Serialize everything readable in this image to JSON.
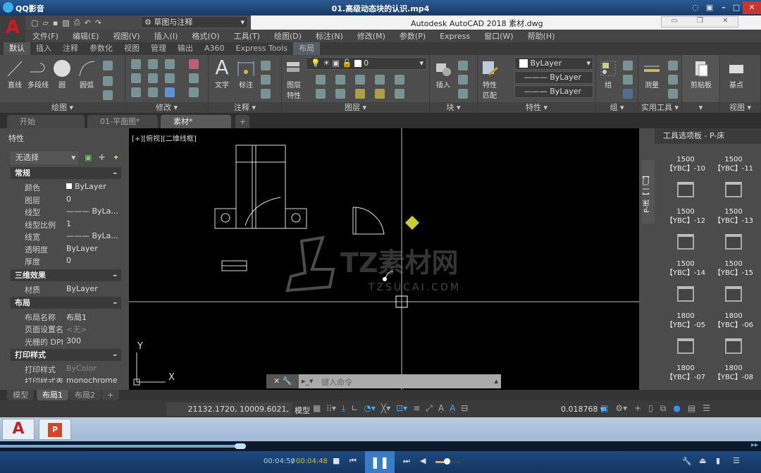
{
  "player": {
    "app_name": "QQ影音",
    "title": "01.高级动态块的认识.mp4",
    "time_current": "00:04:50",
    "time_total": "00:04:48",
    "progress_fraction": 0.32,
    "volume_fraction": 0.45
  },
  "acad": {
    "title": "Autodesk AutoCAD 2018    素材.dwg",
    "logo": "A",
    "workspace": "草图与注释"
  },
  "menu": [
    "文件(F)",
    "编辑(E)",
    "视图(V)",
    "插入(I)",
    "格式(O)",
    "工具(T)",
    "绘图(D)",
    "标注(N)",
    "修改(M)",
    "参数(P)",
    "Express",
    "窗口(W)",
    "帮助(H)"
  ],
  "ribbon_tabs": [
    "默认",
    "插入",
    "注释",
    "参数化",
    "视图",
    "管理",
    "输出",
    "A360",
    "Express Tools",
    "布局"
  ],
  "panels": {
    "draw": {
      "label": "绘图",
      "tools": [
        "直线",
        "多段线",
        "圆",
        "圆弧"
      ]
    },
    "modify": {
      "label": "修改"
    },
    "annotate": {
      "label": "注释",
      "tools": [
        "文字",
        "标注"
      ]
    },
    "layers": {
      "label": "图层",
      "tool": "图层\n特性",
      "layer_value": "0"
    },
    "block": {
      "label": "块",
      "tool": "插入"
    },
    "properties": {
      "label": "特性",
      "tool": "特性\n匹配",
      "color": "ByLayer",
      "linetype": "ByLayer",
      "lineweight": "ByLayer"
    },
    "group": {
      "label": "组",
      "tool": "组"
    },
    "utilities": {
      "label": "实用工具",
      "tool": "测量"
    },
    "clipboard": {
      "tool": "剪贴板"
    },
    "view": {
      "label": "视图",
      "tool": "基点"
    }
  },
  "file_tabs": [
    "开始",
    "01-平面图*",
    "素材*"
  ],
  "properties": {
    "title": "特性",
    "selection": "无选择",
    "sections": [
      {
        "name": "常规",
        "rows": [
          [
            "颜色",
            "ByLayer"
          ],
          [
            "图层",
            "0"
          ],
          [
            "线型",
            "——— ByLa..."
          ],
          [
            "线型比例",
            "1"
          ],
          [
            "线宽",
            "——— ByLa..."
          ],
          [
            "透明度",
            "ByLayer"
          ],
          [
            "厚度",
            "0"
          ]
        ]
      },
      {
        "name": "三维效果",
        "rows": [
          [
            "材质",
            "ByLayer"
          ]
        ]
      },
      {
        "name": "布局",
        "rows": [
          [
            "布局名称",
            "布局1"
          ],
          [
            "页面设置名",
            "<无>"
          ],
          [
            "光栅的 DPI",
            "300"
          ]
        ]
      },
      {
        "name": "打印样式",
        "rows": [
          [
            "打印样式",
            "ByColor"
          ],
          [
            "打印样式表",
            "monochrome"
          ]
        ]
      }
    ]
  },
  "viewport_label": "[+][俯视][二维线框]",
  "watermark": {
    "text": "TZ素材网",
    "url": "TZSUCAI.COM"
  },
  "command": {
    "placeholder": "键入命令"
  },
  "palette": {
    "title": "工具选项板 - P-床",
    "side_tab": "P-床【一门】",
    "items": [
      [
        "1500",
        "【YBC】-10"
      ],
      [
        "1500",
        "【YBC】-11"
      ],
      [
        "1500",
        "【YBC】-12"
      ],
      [
        "1500",
        "【YBC】-13"
      ],
      [
        "1500",
        "【YBC】-14"
      ],
      [
        "1500",
        "【YBC】-15"
      ],
      [
        "1800",
        "【YBC】-05"
      ],
      [
        "1800",
        "【YBC】-06"
      ],
      [
        "1800",
        "【YBC】-07"
      ],
      [
        "1800",
        "【YBC】-08"
      ]
    ]
  },
  "layout_tabs": [
    "模型",
    "布局1",
    "布局2",
    "+"
  ],
  "status": {
    "coords": "21132.1720, 10009.6021, 0.0000",
    "mode": "模型",
    "scale": "0.018768"
  },
  "ucs": {
    "x": "X",
    "y": "Y"
  }
}
